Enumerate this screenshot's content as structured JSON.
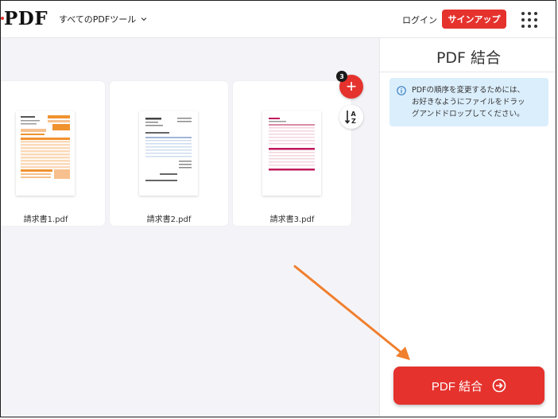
{
  "header": {
    "logo": "PDF",
    "tools_menu": "すべてのPDFツール",
    "login": "ログイン",
    "signup": "サインアップ"
  },
  "workspace": {
    "file_count": "3",
    "add_symbol": "+",
    "files": [
      {
        "name": "請求書1.pdf"
      },
      {
        "name": "請求書2.pdf"
      },
      {
        "name": "請求書3.pdf"
      }
    ]
  },
  "sidebar": {
    "title": "PDF 結合",
    "info_line1": "PDFの順序を変更するためには、",
    "info_line2": "お好きなようにファイルをドラッ",
    "info_line3": "グアンドドロップしてください。",
    "merge_button": "PDF 結合"
  },
  "colors": {
    "brand_red": "#e5322d",
    "info_bg": "#dbeefc",
    "annotation_arrow": "#f07f2e"
  }
}
